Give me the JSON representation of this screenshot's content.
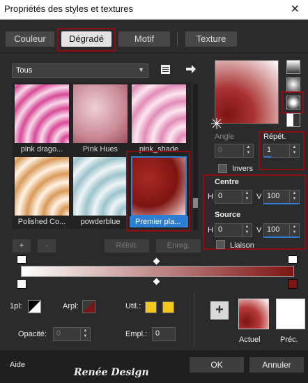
{
  "window": {
    "title": "Propriétés des styles et textures",
    "close_glyph": "✕"
  },
  "tabs": [
    {
      "label": "Couleur"
    },
    {
      "label": "Dégradé",
      "active": true
    },
    {
      "label": "Motif"
    },
    {
      "label": "Texture"
    }
  ],
  "gradient_list": {
    "selected_category": "Tous",
    "items": [
      {
        "label": "pink drago..."
      },
      {
        "label": "Pink Hues"
      },
      {
        "label": "pink_shade"
      },
      {
        "label": "Polished Co..."
      },
      {
        "label": "powderblue"
      },
      {
        "label": "Premier pla...",
        "selected": true
      }
    ]
  },
  "list_buttons": {
    "add": "+",
    "remove": "-",
    "reset": "Réinit.",
    "save": "Enreg."
  },
  "angle": {
    "label": "Angle",
    "value": "0"
  },
  "repeat": {
    "label": "Répét.",
    "value": "1"
  },
  "invert": {
    "label": "Invers"
  },
  "centre": {
    "label": "Centre",
    "h_label": "H",
    "h_value": "0",
    "v_label": "V",
    "v_value": "100"
  },
  "source": {
    "label": "Source",
    "h_label": "H",
    "h_value": "0",
    "v_label": "V",
    "v_value": "100"
  },
  "link": {
    "label": "Liaison"
  },
  "stops": {
    "opacity_label": "1pl:",
    "arpl_label": "Arpl:",
    "util_label": "Util.:",
    "opacity_field_label": "Opacité:",
    "opacity_value": "0",
    "empl_label": "Empl.:",
    "empl_value": "0"
  },
  "preview": {
    "current_label": "Actuel",
    "previous_label": "Préc.",
    "add_glyph": "+"
  },
  "footer": {
    "help": "Aide",
    "watermark": "Renée Design",
    "ok": "OK",
    "cancel": "Annuler"
  },
  "colors": {
    "accent": "#2d7fd3",
    "highlight": "#8c0d12",
    "gradient_dark": "#7e1411",
    "gradient_light": "#ffffff",
    "swatch_yellow": "#f2c81e"
  }
}
